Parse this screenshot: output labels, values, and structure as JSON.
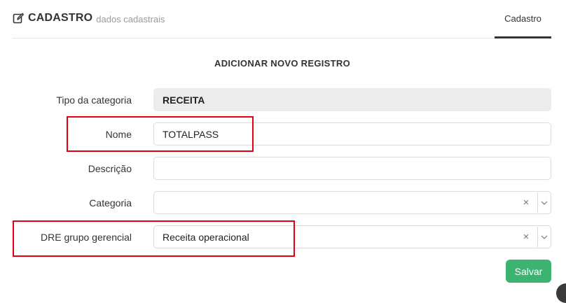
{
  "header": {
    "title": "CADASTRO",
    "subtitle": "dados cadastrais",
    "tab_label": "Cadastro"
  },
  "form": {
    "heading": "ADICIONAR NOVO REGISTRO",
    "tipo_label": "Tipo da categoria",
    "tipo_value": "RECEITA",
    "nome_label": "Nome",
    "nome_value": "TOTALPASS",
    "descricao_label": "Descrição",
    "descricao_value": "",
    "categoria_label": "Categoria",
    "categoria_value": "",
    "dre_label": "DRE grupo gerencial",
    "dre_value": "Receita operacional",
    "clear_glyph": "×",
    "save_label": "Salvar"
  },
  "colors": {
    "highlight": "#e3000f",
    "save_button": "#3cb371"
  },
  "icons": [
    "edit-icon",
    "clear-icon",
    "chevron-down-icon"
  ]
}
